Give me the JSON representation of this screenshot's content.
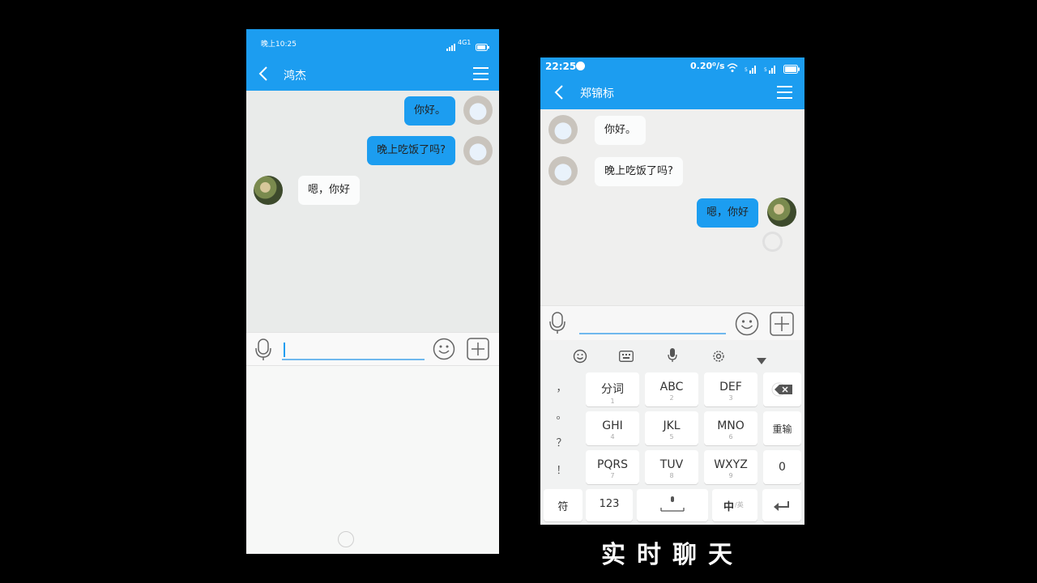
{
  "left": {
    "status": {
      "time": "晚上10:25",
      "network": "4G1"
    },
    "title": "鸿杰",
    "messages": [
      {
        "text": "你好。",
        "dir": "out"
      },
      {
        "text": "晚上吃饭了吗?",
        "dir": "out"
      },
      {
        "text": "嗯，你好",
        "dir": "in"
      }
    ]
  },
  "right": {
    "status": {
      "time": "22:25",
      "speed": "0.20⁰/s"
    },
    "title": "郑锦标",
    "messages": [
      {
        "text": "你好。",
        "dir": "in"
      },
      {
        "text": "晚上吃饭了吗?",
        "dir": "in"
      },
      {
        "text": "嗯，你好",
        "dir": "out"
      }
    ],
    "keyboard": {
      "side_punct": [
        "，",
        "。",
        "？",
        "！"
      ],
      "rows": [
        [
          {
            "main": "分词",
            "sub": "1"
          },
          {
            "main": "ABC",
            "sub": "2"
          },
          {
            "main": "DEF",
            "sub": "3"
          }
        ],
        [
          {
            "main": "GHI",
            "sub": "4"
          },
          {
            "main": "JKL",
            "sub": "5"
          },
          {
            "main": "MNO",
            "sub": "6"
          }
        ],
        [
          {
            "main": "PQRS",
            "sub": "7"
          },
          {
            "main": "TUV",
            "sub": "8"
          },
          {
            "main": "WXYZ",
            "sub": "9"
          }
        ]
      ],
      "retype": "重输",
      "zero": "0",
      "symbols": "符",
      "numbers": "123",
      "lang_main": "中",
      "lang_sub": "/英"
    }
  },
  "caption": "实时聊天",
  "colors": {
    "accent": "#1c9df0"
  }
}
